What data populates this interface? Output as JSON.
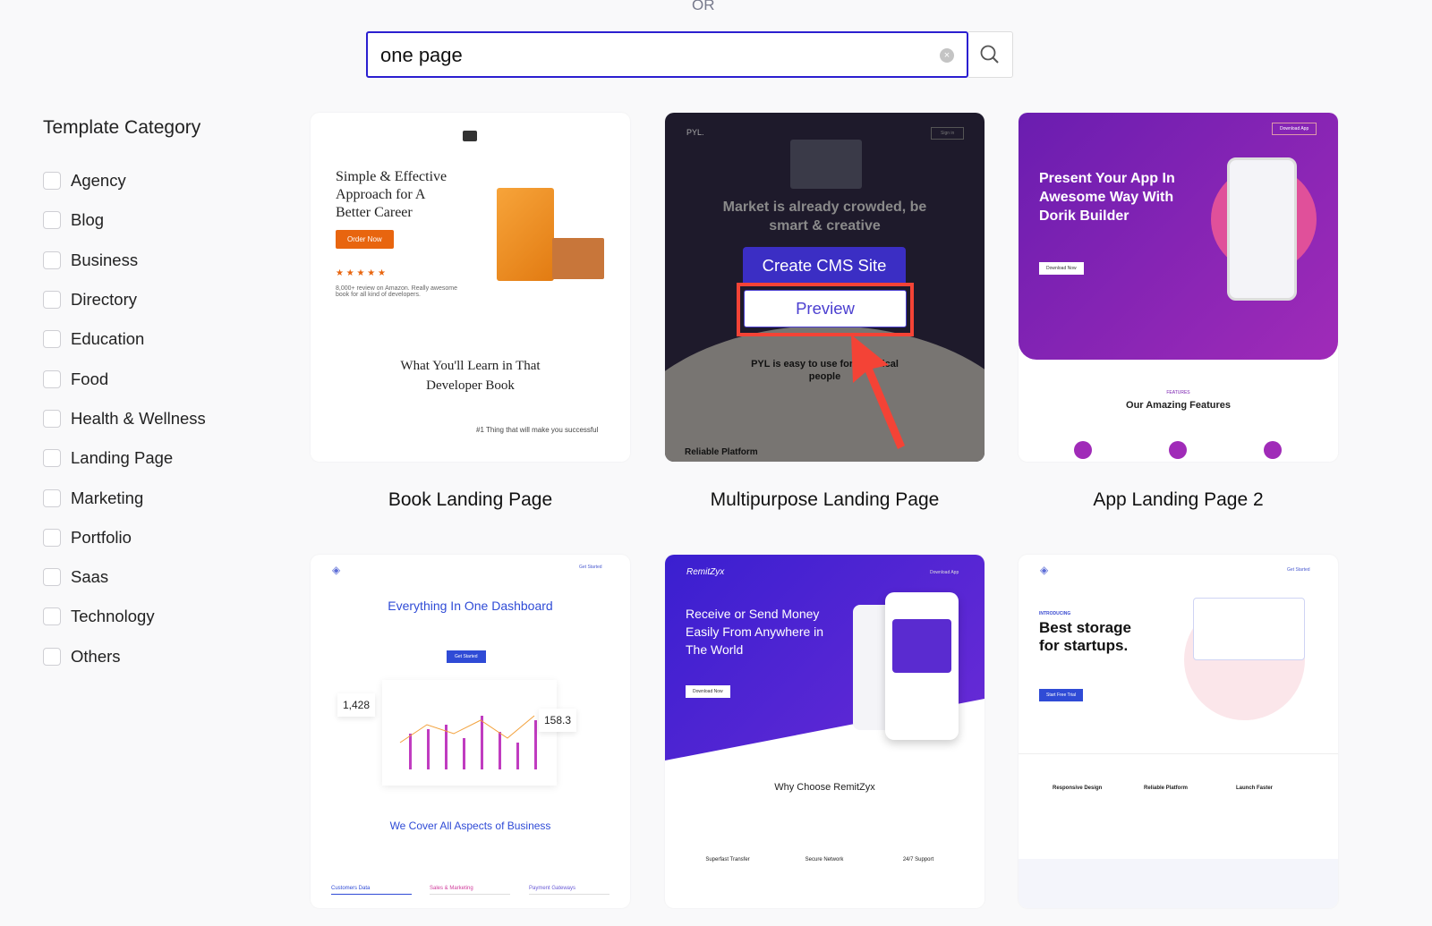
{
  "header": {
    "or_label": "OR"
  },
  "search": {
    "value": "one page",
    "clear_icon": "close-circle-icon",
    "search_icon": "magnifier-icon"
  },
  "sidebar": {
    "title": "Template Category",
    "items": [
      {
        "label": "Agency"
      },
      {
        "label": "Blog"
      },
      {
        "label": "Business"
      },
      {
        "label": "Directory"
      },
      {
        "label": "Education"
      },
      {
        "label": "Food"
      },
      {
        "label": "Health & Wellness"
      },
      {
        "label": "Landing Page"
      },
      {
        "label": "Marketing"
      },
      {
        "label": "Portfolio"
      },
      {
        "label": "Saas"
      },
      {
        "label": "Technology"
      },
      {
        "label": "Others"
      }
    ]
  },
  "templates": [
    {
      "title": "Book Landing Page",
      "preview": {
        "headline": "Simple & Effective Approach for A Better Career",
        "button": "Order Now",
        "review": "8,000+ review on Amazon. Really awesome book for all kind of developers.",
        "section": "What You'll Learn in That Developer Book",
        "sub": "#1 Thing that will make you successful"
      }
    },
    {
      "title": "Multipurpose Landing Page",
      "preview": {
        "brand": "PYL.",
        "signin": "Sign in",
        "headline": "Market is already crowded, be smart & creative",
        "section": "PYL is easy to use for technical people",
        "footer": "Reliable Platform"
      },
      "overlay": {
        "create": "Create CMS Site",
        "preview": "Preview"
      }
    },
    {
      "title": "App Landing Page 2",
      "preview": {
        "headline": "Present Your App In Awesome Way With Dorik Builder",
        "button": "Download Now",
        "cta": "Download App",
        "features_kicker": "FEATURES",
        "features": "Our Amazing Features"
      }
    },
    {
      "title": "",
      "preview": {
        "headline": "Everything In One Dashboard",
        "button": "Get Started",
        "cta": "Get Started",
        "stat1": "1,428",
        "stat2": "158.3",
        "section": "We Cover All Aspects of Business",
        "tabs": [
          "Customers Data",
          "Sales & Marketing",
          "Payment Gateways"
        ]
      }
    },
    {
      "title": "",
      "preview": {
        "brand": "RemitZyx",
        "cta": "Download App",
        "headline": "Receive or Send Money Easily From Anywhere in The World",
        "button": "Download Now",
        "section": "Why Choose RemitZyx",
        "features": [
          "Superfast Transfer",
          "Secure Network",
          "24/7 Support"
        ]
      }
    },
    {
      "title": "",
      "preview": {
        "kicker": "INTRODUCING",
        "headline": "Best storage for startups.",
        "button": "Start Free Trial",
        "cta": "Get Started",
        "features": [
          "Responsive Design",
          "Reliable Platform",
          "Launch Faster"
        ]
      }
    }
  ],
  "colors": {
    "accent": "#2b1fd0",
    "highlight": "#f44336",
    "purple": "#7a1fb0"
  }
}
